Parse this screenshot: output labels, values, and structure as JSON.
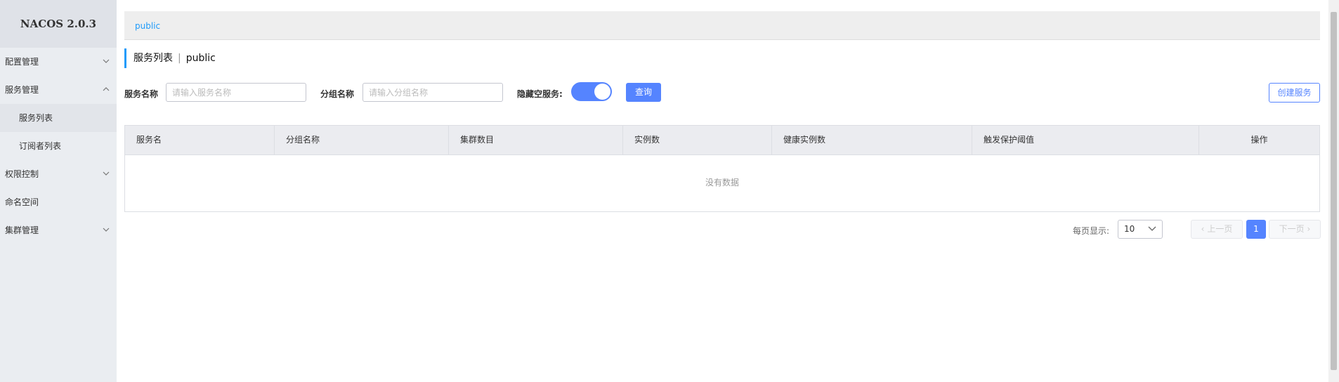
{
  "app": {
    "title": "NACOS 2.0.3"
  },
  "sidebar": {
    "items": [
      {
        "label": "配置管理"
      },
      {
        "label": "服务管理"
      },
      {
        "label": "服务列表"
      },
      {
        "label": "订阅者列表"
      },
      {
        "label": "权限控制"
      },
      {
        "label": "命名空间"
      },
      {
        "label": "集群管理"
      }
    ]
  },
  "namespace_bar": {
    "tab": "public"
  },
  "page": {
    "title": "服务列表",
    "separator": "|",
    "namespace": "public"
  },
  "filters": {
    "service_name_label": "服务名称",
    "service_name_placeholder": "请输入服务名称",
    "group_name_label": "分组名称",
    "group_name_placeholder": "请输入分组名称",
    "hide_empty_label": "隐藏空服务:",
    "hide_empty_on": true,
    "query_button": "查询",
    "create_button": "创建服务"
  },
  "table": {
    "columns": [
      "服务名",
      "分组名称",
      "集群数目",
      "实例数",
      "健康实例数",
      "触发保护阈值",
      "操作"
    ],
    "rows": [],
    "empty_text": "没有数据"
  },
  "pagination": {
    "page_size_label": "每页显示:",
    "page_size": "10",
    "prev": "上一页",
    "next": "下一页",
    "current_page": "1"
  },
  "colors": {
    "accent": "#5584ff",
    "link": "#209bfa",
    "sidebar_bg": "#eaedf1"
  }
}
